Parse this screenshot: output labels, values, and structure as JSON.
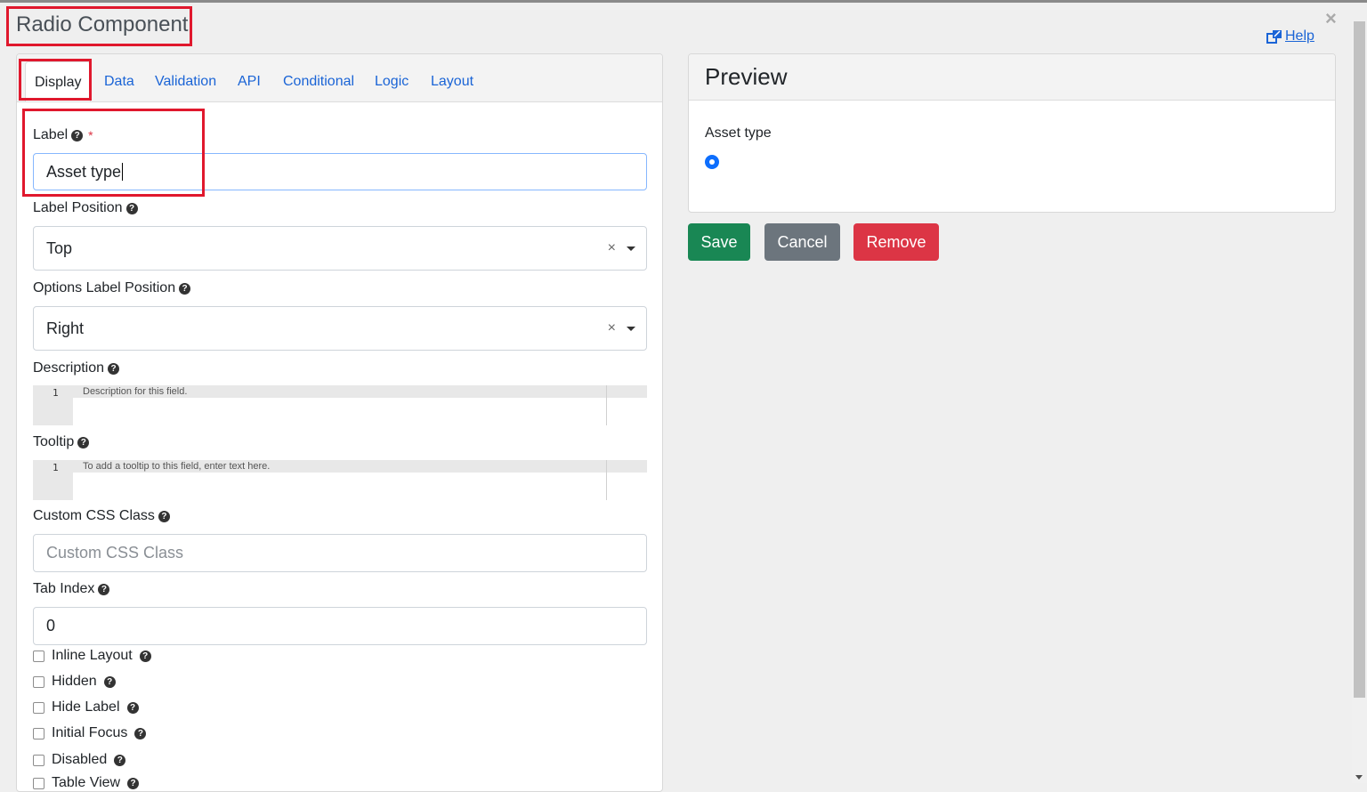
{
  "modal": {
    "title": "Radio Component",
    "close": "×",
    "help": "Help"
  },
  "tabs": [
    "Display",
    "Data",
    "Validation",
    "API",
    "Conditional",
    "Logic",
    "Layout"
  ],
  "form": {
    "label": {
      "label": "Label",
      "required": "*",
      "value": "Asset type"
    },
    "label_position": {
      "label": "Label Position",
      "value": "Top"
    },
    "options_label_position": {
      "label": "Options Label Position",
      "value": "Right"
    },
    "description": {
      "label": "Description",
      "line": "1",
      "placeholder": "Description for this field."
    },
    "tooltip": {
      "label": "Tooltip",
      "line": "1",
      "placeholder": "To add a tooltip to this field, enter text here."
    },
    "custom_css": {
      "label": "Custom CSS Class",
      "placeholder": "Custom CSS Class"
    },
    "tab_index": {
      "label": "Tab Index",
      "value": "0"
    },
    "checkboxes": [
      "Inline Layout",
      "Hidden",
      "Hide Label",
      "Initial Focus",
      "Disabled",
      "Table View"
    ]
  },
  "preview": {
    "title": "Preview",
    "field_label": "Asset type"
  },
  "buttons": {
    "save": "Save",
    "cancel": "Cancel",
    "remove": "Remove"
  },
  "colors": {
    "link": "#1a64d6",
    "highlight": "#e0182d",
    "save": "#198754",
    "cancel": "#6c757d",
    "remove": "#dc3545",
    "radio": "#0d6efd"
  }
}
